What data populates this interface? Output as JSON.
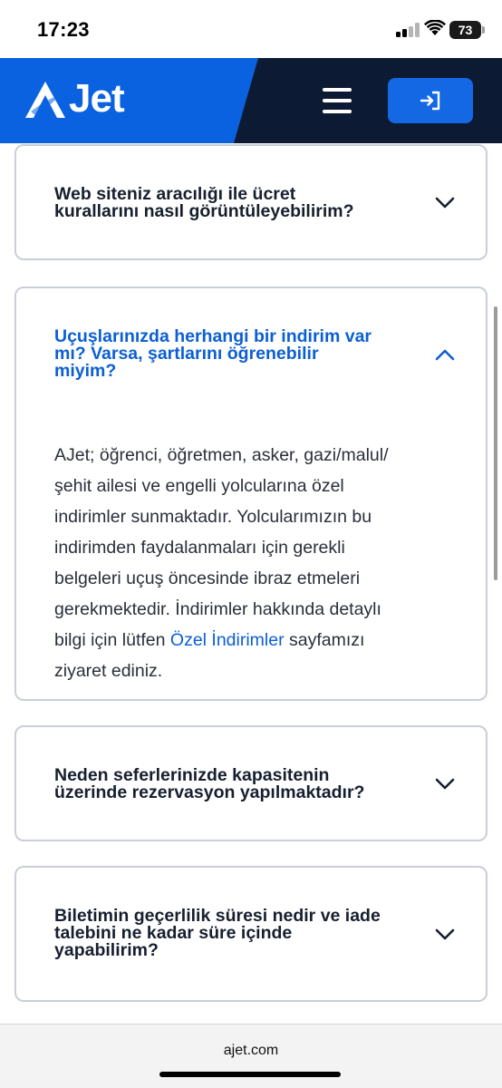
{
  "status_bar": {
    "time": "17:23",
    "battery_level": "73",
    "icons": [
      "signal-icon",
      "wifi-icon",
      "battery-icon"
    ]
  },
  "header": {
    "logo_text": "Jet",
    "logo_icon": "ajet-a-logo",
    "menu_icon": "hamburger-menu-icon",
    "login_icon": "login-arrow-icon"
  },
  "faq": {
    "items": [
      {
        "question_lines": [
          "Web siteniz aracılığı ile ücret",
          "kurallarını nasıl görüntüleyebilirim?"
        ],
        "expanded": false
      },
      {
        "question_lines": [
          "Uçuşlarınızda herhangi bir indirim var",
          "mı? Varsa, şartlarını öğrenebilir",
          "miyim?"
        ],
        "expanded": true,
        "answer_lines": [
          "AJet; öğrenci, öğretmen, asker, gazi/malul/",
          "şehit ailesi ve engelli yolcularına özel",
          "indirimler sunmaktadır. Yolcularımızın bu",
          "indirimden faydalanmaları için gerekli",
          "belgeleri uçuş öncesinde ibraz etmeleri",
          "gerekmektedir. İndirimler hakkında detaylı"
        ],
        "answer_link_prefix": "bilgi için lütfen ",
        "answer_link_text": "Özel İndirimler",
        "answer_link_suffix": " sayfamızı",
        "answer_last_line": "ziyaret ediniz."
      },
      {
        "question_lines": [
          "Neden seferlerinizde kapasitenin",
          "üzerinde rezervasyon yapılmaktadır?"
        ],
        "expanded": false
      },
      {
        "question_lines": [
          "Biletimin geçerlilik süresi nedir ve iade",
          "talebini ne kadar süre içinde",
          "yapabilirim?"
        ],
        "expanded": false
      }
    ]
  },
  "browser": {
    "url": "ajet.com"
  },
  "colors": {
    "brand_blue": "#0a62e0",
    "header_dark": "#0c1a33",
    "link_blue": "#0b5fd4",
    "card_border": "#c9ced8",
    "text_dark": "#171f2e"
  }
}
